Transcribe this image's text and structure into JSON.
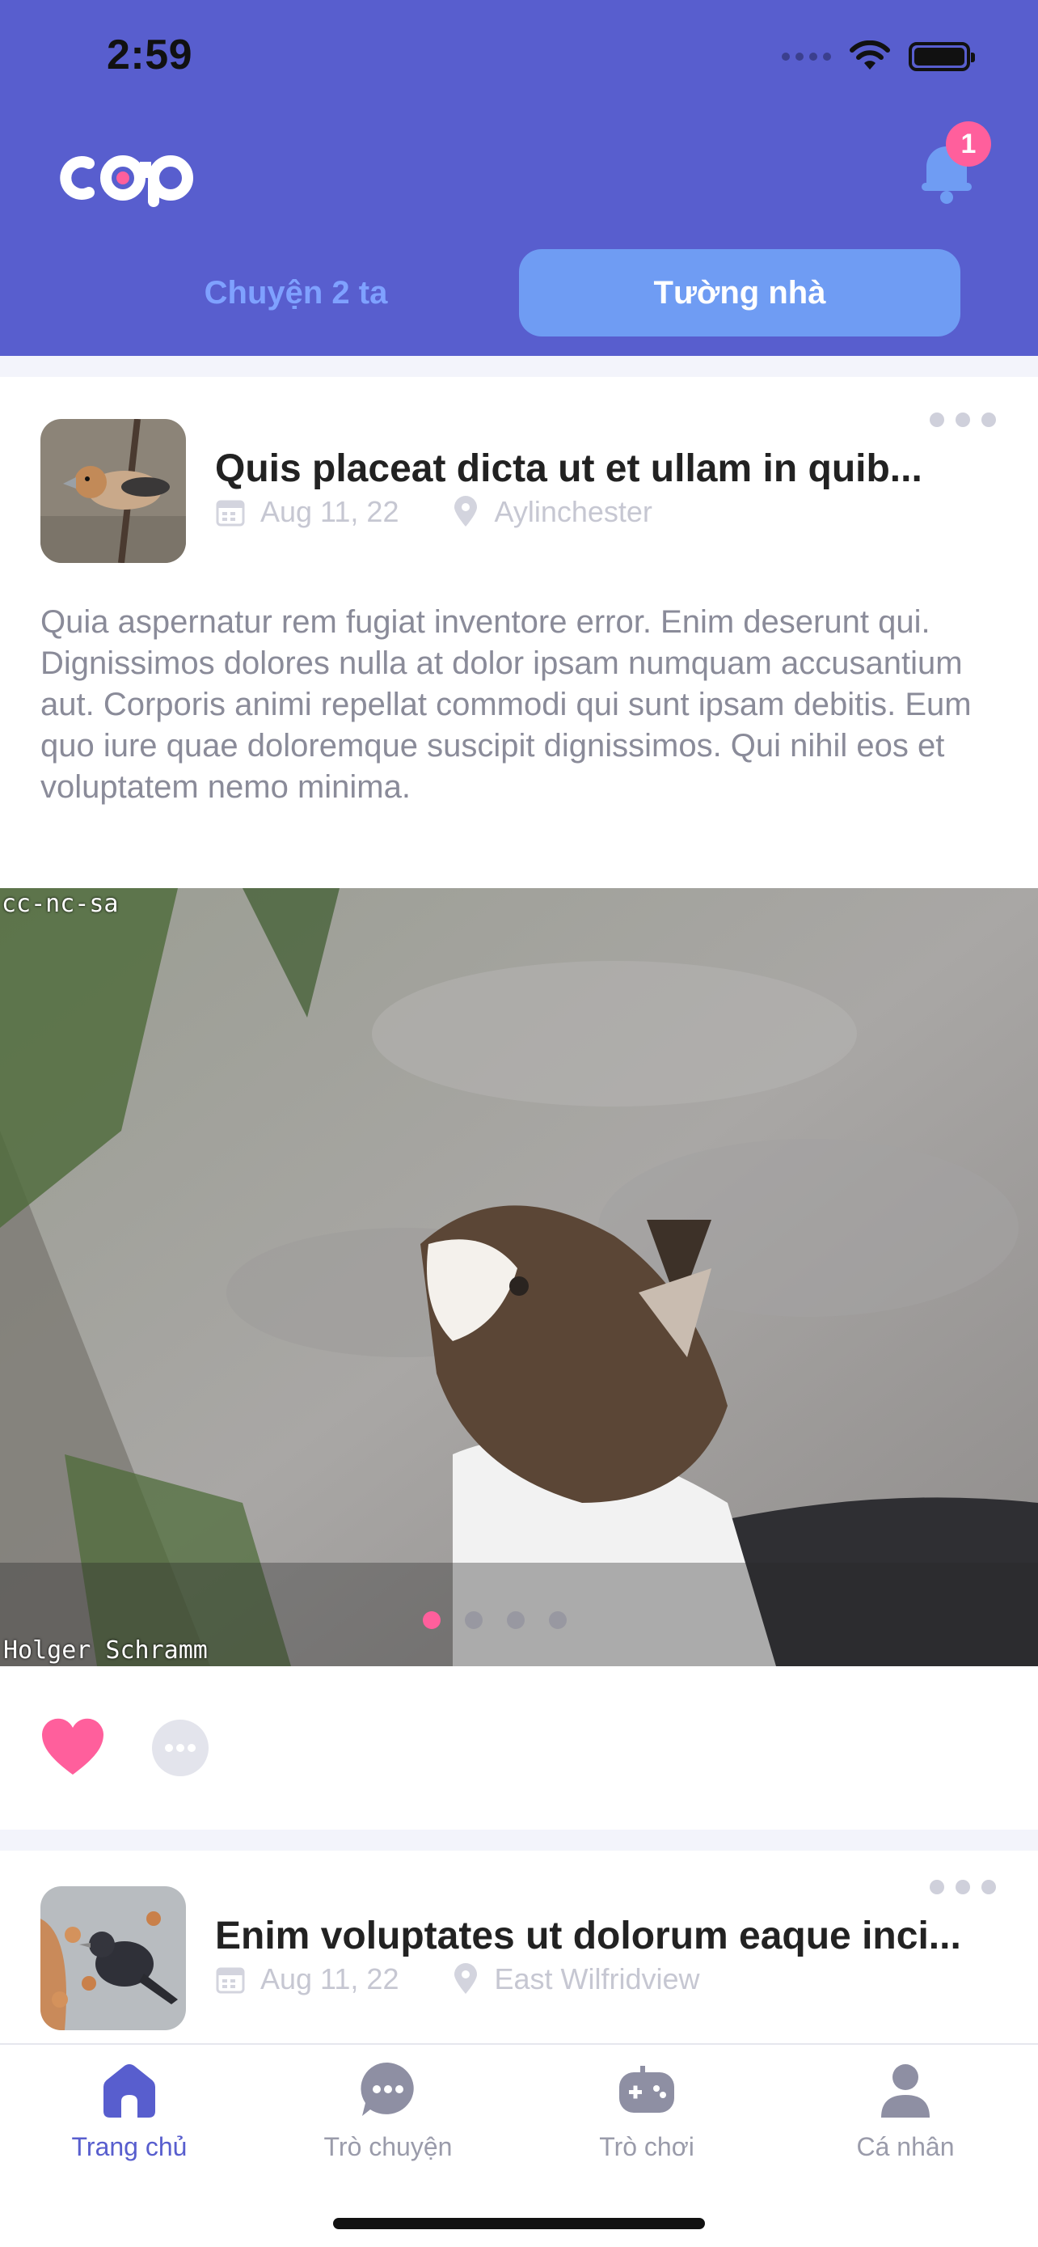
{
  "status_bar": {
    "time": "2:59"
  },
  "header": {
    "logo_text": "cap",
    "notification_count": "1",
    "tabs": [
      {
        "label": "Chuyện 2 ta",
        "active": false
      },
      {
        "label": "Tường nhà",
        "active": true
      }
    ]
  },
  "posts": [
    {
      "title": "Quis placeat dicta ut et ullam in quib...",
      "date": "Aug 11, 22",
      "location": "Aylinchester",
      "body": "Quia aspernatur rem fugiat inventore error. Enim deserunt qui. Dignissimos dolores nulla at dolor ipsam numquam accusantium aut. Corporis animi repellat commodi qui sunt ipsam debitis. Eum quo iure quae doloremque suscipit dignissimos. Qui nihil eos et voluptatem nemo minima.",
      "image": {
        "caption_top": "cc-nc-sa",
        "caption_bottom": "Holger Schramm",
        "slide_count": 4,
        "active_slide": 1
      },
      "liked": true
    },
    {
      "title": "Enim voluptates ut dolorum eaque inci...",
      "date": "Aug 11, 22",
      "location": "East Wilfridview"
    }
  ],
  "tabbar": {
    "items": [
      {
        "label": "Trang chủ",
        "icon": "home-icon",
        "active": true
      },
      {
        "label": "Trò chuyện",
        "icon": "chat-icon",
        "active": false
      },
      {
        "label": "Trò chơi",
        "icon": "gamepad-icon",
        "active": false
      },
      {
        "label": "Cá nhân",
        "icon": "user-icon",
        "active": false
      }
    ]
  },
  "colors": {
    "brand": "#585ece",
    "accent_pink": "#ff5f9c",
    "tab_active": "#6f9cf3"
  }
}
